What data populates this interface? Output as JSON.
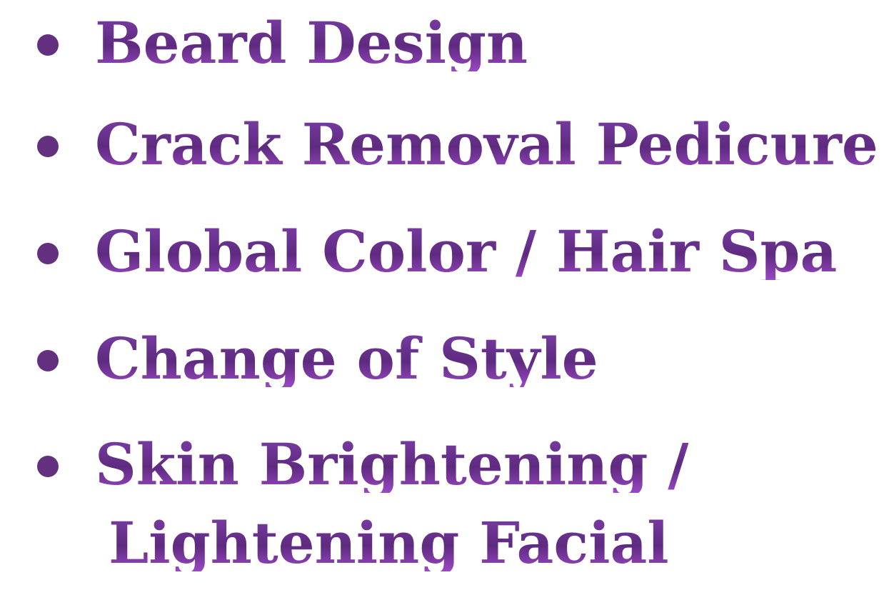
{
  "colors": {
    "text_gradient_top": "#7a3da6",
    "text_gradient_mid": "#5e2a7f",
    "text_gradient_bottom": "#9a48c4",
    "bullet_color": "#63307f",
    "background": "#ffffff"
  },
  "services": [
    {
      "label": "Beard Design"
    },
    {
      "label": "Crack Removal Pedicure"
    },
    {
      "label": "Global Color / Hair Spa"
    },
    {
      "label": "Change of Style"
    },
    {
      "label": "Skin Brightening /",
      "continuation": "Lightening Facial"
    }
  ]
}
